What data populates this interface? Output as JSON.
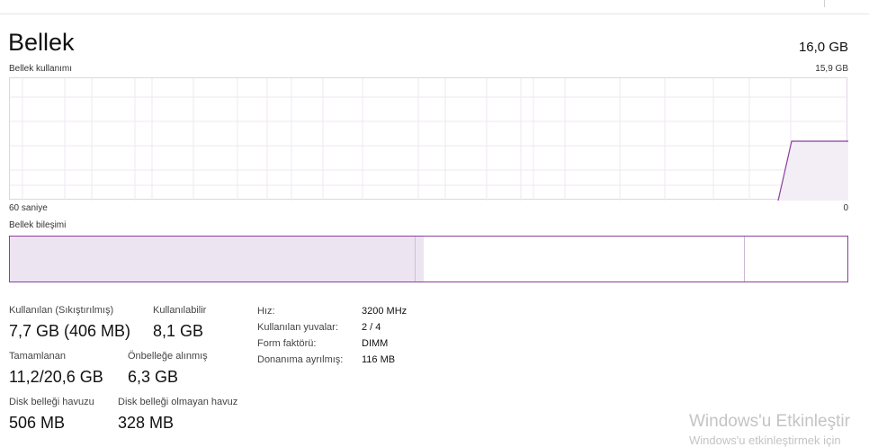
{
  "header": {
    "title": "Bellek",
    "total": "16,0 GB"
  },
  "usage_graph": {
    "label": "Bellek kullanımı",
    "max_label": "15,9 GB",
    "x_left_label": "60 saniye",
    "x_right_label": "0",
    "line_color": "#8b3f9e",
    "fill_color": "#f3eef6"
  },
  "composition": {
    "label": "Bellek bileşimi",
    "border_color": "#8b3f9e",
    "in_use_fill": "#ede4f1",
    "segments_fraction": {
      "in_use": 0.483,
      "modified": 0.011,
      "standby": 0.384,
      "free": 0.122
    }
  },
  "stats": {
    "in_use_label": "Kullanılan (Sıkıştırılmış)",
    "in_use_value": "7,7 GB (406 MB)",
    "available_label": "Kullanılabilir",
    "available_value": "8,1 GB",
    "committed_label": "Tamamlanan",
    "committed_value": "11,2/20,6 GB",
    "cached_label": "Önbelleğe alınmış",
    "cached_value": "6,3 GB",
    "paged_pool_label": "Disk belleği havuzu",
    "paged_pool_value": "506 MB",
    "nonpaged_pool_label": "Disk belleği olmayan havuz",
    "nonpaged_pool_value": "328 MB"
  },
  "details": {
    "speed_label": "Hız:",
    "speed_value": "3200 MHz",
    "slots_label": "Kullanılan yuvalar:",
    "slots_value": "2 / 4",
    "form_label": "Form faktörü:",
    "form_value": "DIMM",
    "reserved_label": "Donanıma ayrılmış:",
    "reserved_value": "116 MB"
  },
  "watermark": {
    "line1": "Windows'u Etkinleştir",
    "line2": "Windows'u etkinleştirmek için"
  }
}
